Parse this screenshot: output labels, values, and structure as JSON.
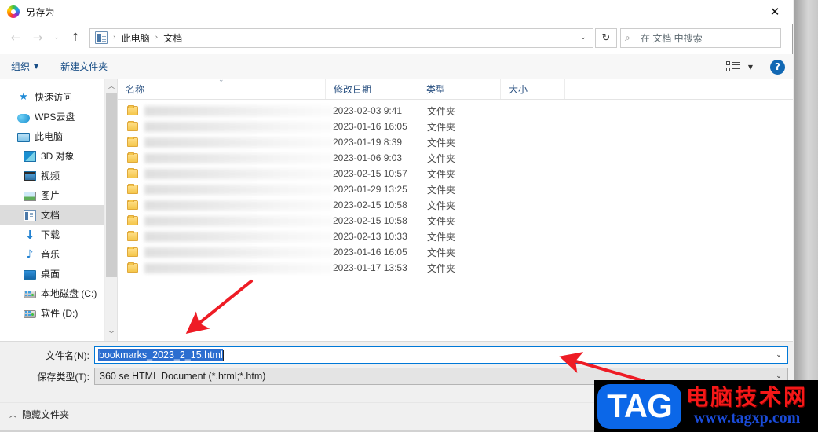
{
  "window": {
    "title": "另存为",
    "app_icon": "360-browser-icon",
    "close_label": "✕"
  },
  "nav": {
    "back_icon": "back-arrow-icon",
    "forward_icon": "forward-arrow-icon",
    "recent_icon": "chevron-down-icon",
    "up_icon": "up-arrow-icon",
    "address_icon": "documents-folder-icon",
    "breadcrumbs": [
      "此电脑",
      "文档"
    ],
    "separator": "›",
    "dropdown_icon": "chevron-down-icon",
    "refresh_icon": "refresh-icon",
    "refresh_glyph": "↻"
  },
  "search": {
    "icon": "search-icon",
    "placeholder": "在 文档 中搜索",
    "value": ""
  },
  "toolbar": {
    "organize_label": "组织",
    "organize_caret": "▼",
    "new_folder_label": "新建文件夹",
    "view_icon": "view-options-icon",
    "view_caret": "▼",
    "help_icon": "help-icon",
    "help_label": "?"
  },
  "sidebar": {
    "items": [
      {
        "label": "快速访问",
        "icon": "quick-access-star-icon",
        "indent": 0,
        "selected": false
      },
      {
        "label": "WPS云盘",
        "icon": "wps-cloud-icon",
        "indent": 0,
        "selected": false
      },
      {
        "label": "此电脑",
        "icon": "this-pc-icon",
        "indent": 0,
        "selected": false
      },
      {
        "label": "3D 对象",
        "icon": "3d-objects-icon",
        "indent": 1,
        "selected": false
      },
      {
        "label": "视频",
        "icon": "videos-icon",
        "indent": 1,
        "selected": false
      },
      {
        "label": "图片",
        "icon": "pictures-icon",
        "indent": 1,
        "selected": false
      },
      {
        "label": "文档",
        "icon": "documents-icon",
        "indent": 1,
        "selected": true
      },
      {
        "label": "下载",
        "icon": "downloads-icon",
        "indent": 1,
        "selected": false
      },
      {
        "label": "音乐",
        "icon": "music-icon",
        "indent": 1,
        "selected": false
      },
      {
        "label": "桌面",
        "icon": "desktop-icon",
        "indent": 1,
        "selected": false
      },
      {
        "label": "本地磁盘 (C:)",
        "icon": "local-disk-c-icon",
        "indent": 1,
        "selected": false
      },
      {
        "label": "软件 (D:)",
        "icon": "drive-d-icon",
        "indent": 1,
        "selected": false
      }
    ],
    "scroll_up_icon": "scroll-up-icon",
    "scroll_down_icon": "scroll-down-icon",
    "scroll_up_glyph": "︿",
    "scroll_down_glyph": "﹀"
  },
  "filelist": {
    "columns": [
      {
        "key": "name",
        "label": "名称"
      },
      {
        "key": "date",
        "label": "修改日期"
      },
      {
        "key": "type",
        "label": "类型"
      },
      {
        "key": "size",
        "label": "大小"
      }
    ],
    "sort_caret": "⌄",
    "rows": [
      {
        "name": "",
        "date": "2023-02-03 9:41",
        "type": "文件夹",
        "size": ""
      },
      {
        "name": "",
        "date": "2023-01-16 16:05",
        "type": "文件夹",
        "size": ""
      },
      {
        "name": "",
        "date": "2023-01-19 8:39",
        "type": "文件夹",
        "size": ""
      },
      {
        "name": "",
        "date": "2023-01-06 9:03",
        "type": "文件夹",
        "size": ""
      },
      {
        "name": "",
        "date": "2023-02-15 10:57",
        "type": "文件夹",
        "size": ""
      },
      {
        "name": "",
        "date": "2023-01-29 13:25",
        "type": "文件夹",
        "size": ""
      },
      {
        "name": "",
        "date": "2023-02-15 10:58",
        "type": "文件夹",
        "size": ""
      },
      {
        "name": "",
        "date": "2023-02-15 10:58",
        "type": "文件夹",
        "size": ""
      },
      {
        "name": "",
        "date": "2023-02-13 10:33",
        "type": "文件夹",
        "size": ""
      },
      {
        "name": "",
        "date": "2023-01-16 16:05",
        "type": "文件夹",
        "size": ""
      },
      {
        "name": "",
        "date": "2023-01-17 13:53",
        "type": "文件夹",
        "size": ""
      }
    ]
  },
  "form": {
    "filename_label": "文件名(N):",
    "filename_value": "bookmarks_2023_2_15.html",
    "filename_dropdown_icon": "chevron-down-icon",
    "filetype_label": "保存类型(T):",
    "filetype_value": "360 se HTML Document (*.html;*.htm)",
    "filetype_dropdown_icon": "chevron-down-icon",
    "dropdown_glyph": "⌄"
  },
  "footer": {
    "hide_folders_label": "隐藏文件夹",
    "hide_folders_caret": "︿"
  },
  "watermark": {
    "badge_text": "TAG",
    "site_name": "电脑技术网",
    "site_url": "www.tagxp.com"
  },
  "annotations": {
    "arrow1": "red-arrow-to-filename-field",
    "arrow2": "red-arrow-to-filename-dropdown"
  },
  "colors": {
    "accent": "#0078d7",
    "selection": "#2b6ed0",
    "link": "#1a4f87",
    "watermark_blue": "#0b67e8",
    "watermark_red": "#f51818",
    "arrow_red": "#ee1c25"
  }
}
